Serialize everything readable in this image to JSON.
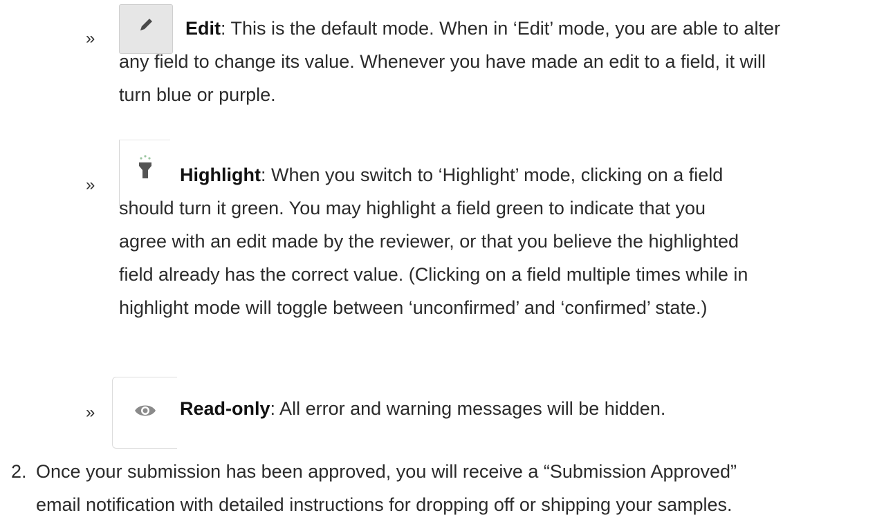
{
  "modes": [
    {
      "icon": "pencil-icon",
      "name": "Edit",
      "sep": ":",
      "first_line_rest": "  This is the default mode. When in ‘Edit’ mode, you are able to alter",
      "lines": [
        "any field to change its value. Whenever you have made an edit to a field, it will",
        "turn blue or purple."
      ]
    },
    {
      "icon": "flashlight-icon",
      "name": "Highlight",
      "sep": ":",
      "first_line_rest": "  When you switch to ‘Highlight’ mode, clicking on a field",
      "lines": [
        "should turn it green. You may highlight a field green to indicate that you",
        "agree with an edit made by the reviewer, or that you believe the highlighted",
        "field already has the correct value. (Clicking on a field multiple times while in",
        "highlight mode will toggle between ‘unconfirmed’ and ‘confirmed’ state.)"
      ]
    },
    {
      "icon": "eye-icon",
      "name": "Read-only",
      "sep": ":",
      "first_line_rest": "  All error and warning messages will be hidden.",
      "lines": []
    }
  ],
  "bullet_glyph": "»",
  "step2": {
    "number": "2.",
    "lines": [
      "Once your submission has been approved, you will receive a “Submission Approved”",
      "email notification with detailed instructions for dropping off or shipping your samples."
    ]
  }
}
